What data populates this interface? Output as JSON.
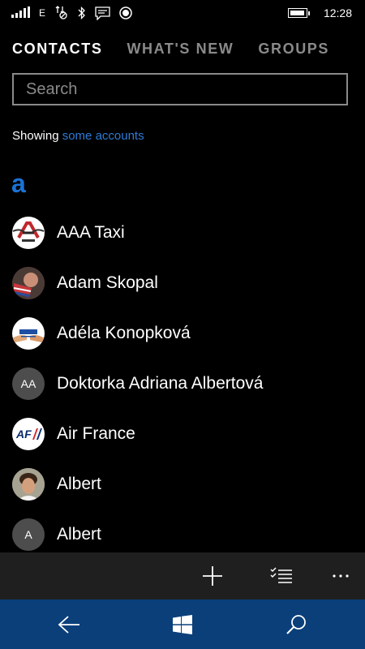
{
  "status_bar": {
    "network": "E",
    "time": "12:28"
  },
  "tabs": [
    {
      "label": "CONTACTS"
    },
    {
      "label": "WHAT'S NEW"
    },
    {
      "label": "GROUPS"
    }
  ],
  "search": {
    "placeholder": "Search"
  },
  "showing": {
    "prefix": "Showing",
    "link": "some accounts"
  },
  "group_letter": "a",
  "contacts": [
    {
      "name": "AAA Taxi",
      "avatar": "photo"
    },
    {
      "name": "Adam Skopal",
      "avatar": "photo"
    },
    {
      "name": "Adéla Konopková",
      "avatar": "photo"
    },
    {
      "name": "Doktorka Adriana Albertová",
      "avatar": "initials",
      "initials": "AA"
    },
    {
      "name": "Air France",
      "avatar": "photo"
    },
    {
      "name": "Albert",
      "avatar": "photo"
    },
    {
      "name": "Albert",
      "avatar": "initials",
      "initials": "A"
    }
  ],
  "app_bar": {
    "icons": [
      "add-icon",
      "select-icon",
      "more-icon"
    ]
  },
  "nav_bar": {
    "icons": [
      "back-icon",
      "windows-start-icon",
      "search-icon"
    ]
  },
  "colors": {
    "accent": "#1a73d6",
    "link": "#2d7bd6",
    "nav_bar": "#0a3f7a",
    "app_bar": "#1f1f1f"
  }
}
